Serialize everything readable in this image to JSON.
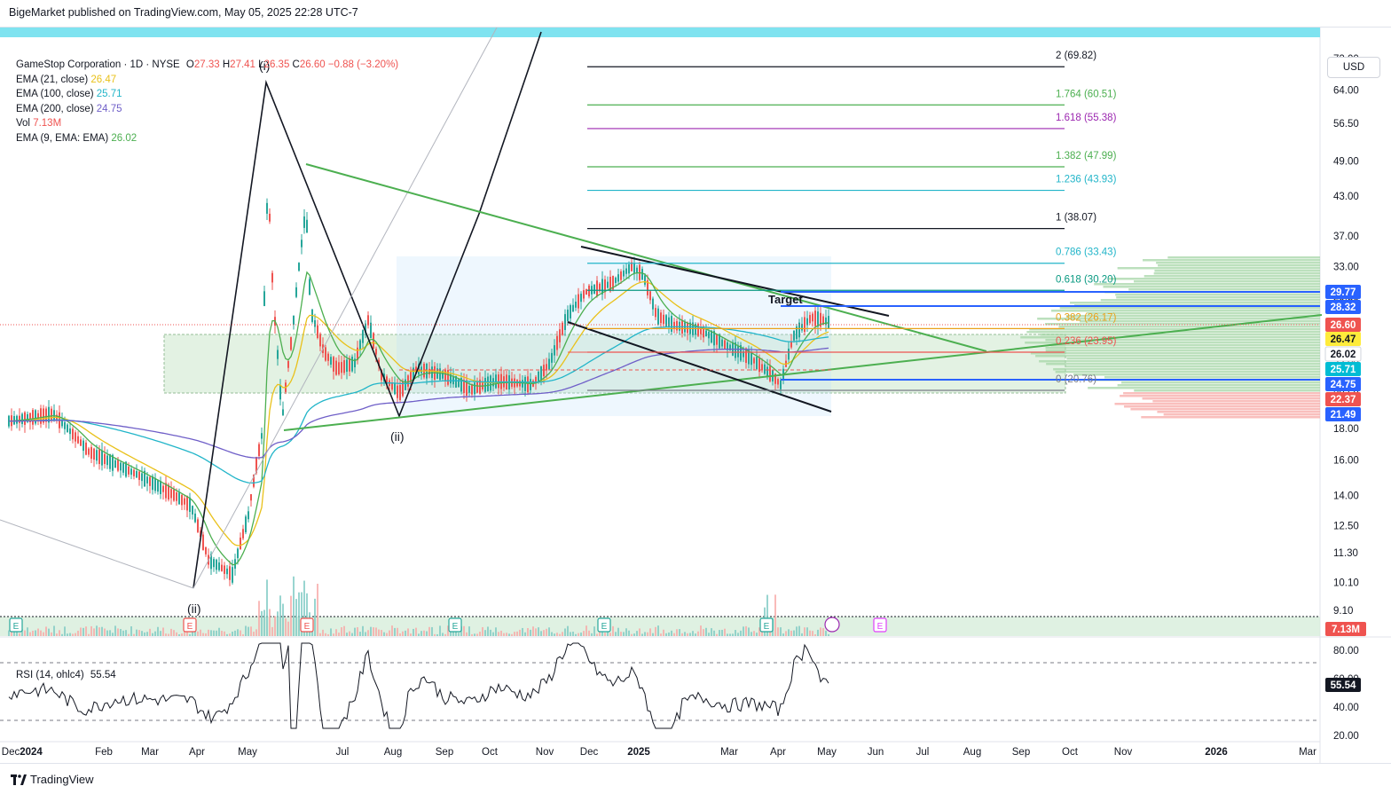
{
  "header": {
    "publisher": "BigeMarket published on TradingView.com, May 05, 2025 22:28 UTC-7"
  },
  "legend": {
    "symbol": "GameStop Corporation · 1D · NYSE",
    "ohlc": {
      "o_label": "O",
      "o": "27.33",
      "h_label": "H",
      "h": "27.41",
      "l_label": "L",
      "l": "26.35",
      "c_label": "C",
      "c": "26.60",
      "chg": "−0.88 (−3.20%)"
    },
    "indicators": [
      {
        "label": "EMA (21, close)",
        "value": "26.47",
        "color": "#e9c11a"
      },
      {
        "label": "EMA (100, close)",
        "value": "25.71",
        "color": "#22b5c9"
      },
      {
        "label": "EMA (200, close)",
        "value": "24.75",
        "color": "#6f5fc8"
      },
      {
        "label": "Vol",
        "value": "7.13M",
        "color": "#ef5350"
      },
      {
        "label": "EMA (9, EMA: EMA)",
        "value": "26.02",
        "color": "#4caf50"
      }
    ]
  },
  "currency": "USD",
  "rsi": {
    "label": "RSI (14, ohlc4)",
    "value": "55.54"
  },
  "footer": {
    "brand": "TradingView"
  },
  "colors": {
    "up": "#26a69a",
    "down": "#ef5350",
    "fib_black": "#131722",
    "ema21": "#e9c11a",
    "ema100": "#22b5c9",
    "ema200": "#6f5fc8",
    "ema9": "#4caf50",
    "trendline": "#4caf50",
    "blue_level": "#2962ff"
  },
  "chart_data": {
    "type": "candlestick",
    "title": "GameStop Corporation · 1D · NYSE",
    "price_scale": "log",
    "price_axis_ticks": [
      "72.00",
      "64.00",
      "56.50",
      "49.00",
      "43.00",
      "37.00",
      "33.00",
      "29.50",
      "26.00",
      "23.00",
      "20.50",
      "18.00",
      "16.00",
      "14.00",
      "12.50",
      "11.30",
      "10.10",
      "9.10"
    ],
    "time_axis_ticks": [
      "Dec",
      "2024",
      "Feb",
      "Mar",
      "Apr",
      "May",
      "Jul",
      "Aug",
      "Sep",
      "Oct",
      "Nov",
      "Dec",
      "2025",
      "Mar",
      "Apr",
      "May",
      "Jun",
      "Jul",
      "Aug",
      "Sep",
      "Oct",
      "Nov",
      "2026",
      "Mar"
    ],
    "price_tags": [
      {
        "value": "29.77",
        "bg": "#2962ff"
      },
      {
        "value": "28.32",
        "bg": "#2962ff"
      },
      {
        "value": "26.60",
        "bg": "#ef5350"
      },
      {
        "value": "26.47",
        "bg": "#ffeb3b"
      },
      {
        "value": "26.02",
        "bg": "#ffffff"
      },
      {
        "value": "25.71",
        "bg": "#00bcd4"
      },
      {
        "value": "24.75",
        "bg": "#2962ff"
      },
      {
        "value": "22.37",
        "bg": "#ef5350"
      },
      {
        "value": "21.49",
        "bg": "#2962ff"
      }
    ],
    "volume_tag": "7.13M",
    "fib_levels": [
      {
        "label": "2 (69.82)",
        "price": 69.82,
        "color": "#131722"
      },
      {
        "label": "1.764 (60.51)",
        "price": 60.51,
        "color": "#4caf50"
      },
      {
        "label": "1.618 (55.38)",
        "price": 55.38,
        "color": "#9c27b0"
      },
      {
        "label": "1.382 (47.99)",
        "price": 47.99,
        "color": "#4caf50"
      },
      {
        "label": "1.236 (43.93)",
        "price": 43.93,
        "color": "#22b5c9"
      },
      {
        "label": "1 (38.07)",
        "price": 38.07,
        "color": "#131722"
      },
      {
        "label": "0.786 (33.43)",
        "price": 33.43,
        "color": "#22b5c9"
      },
      {
        "label": "0.618 (30.20)",
        "price": 30.2,
        "color": "#089981"
      },
      {
        "label": "0.382 (26.17)",
        "price": 26.17,
        "color": "#e9a11a"
      },
      {
        "label": "0.236 (23.95)",
        "price": 23.95,
        "color": "#ef5350"
      },
      {
        "label": "0 (20.76)",
        "price": 20.76,
        "color": "#787b86"
      }
    ],
    "annotations": [
      "(i)",
      "(ii)",
      "(ii)",
      "Target"
    ],
    "rsi_axis_ticks": [
      "80.00",
      "60.00",
      "40.00",
      "20.00"
    ],
    "rsi_value": "55.54",
    "earnings_markers": [
      "E",
      "E",
      "E",
      "E",
      "E",
      "E"
    ]
  }
}
